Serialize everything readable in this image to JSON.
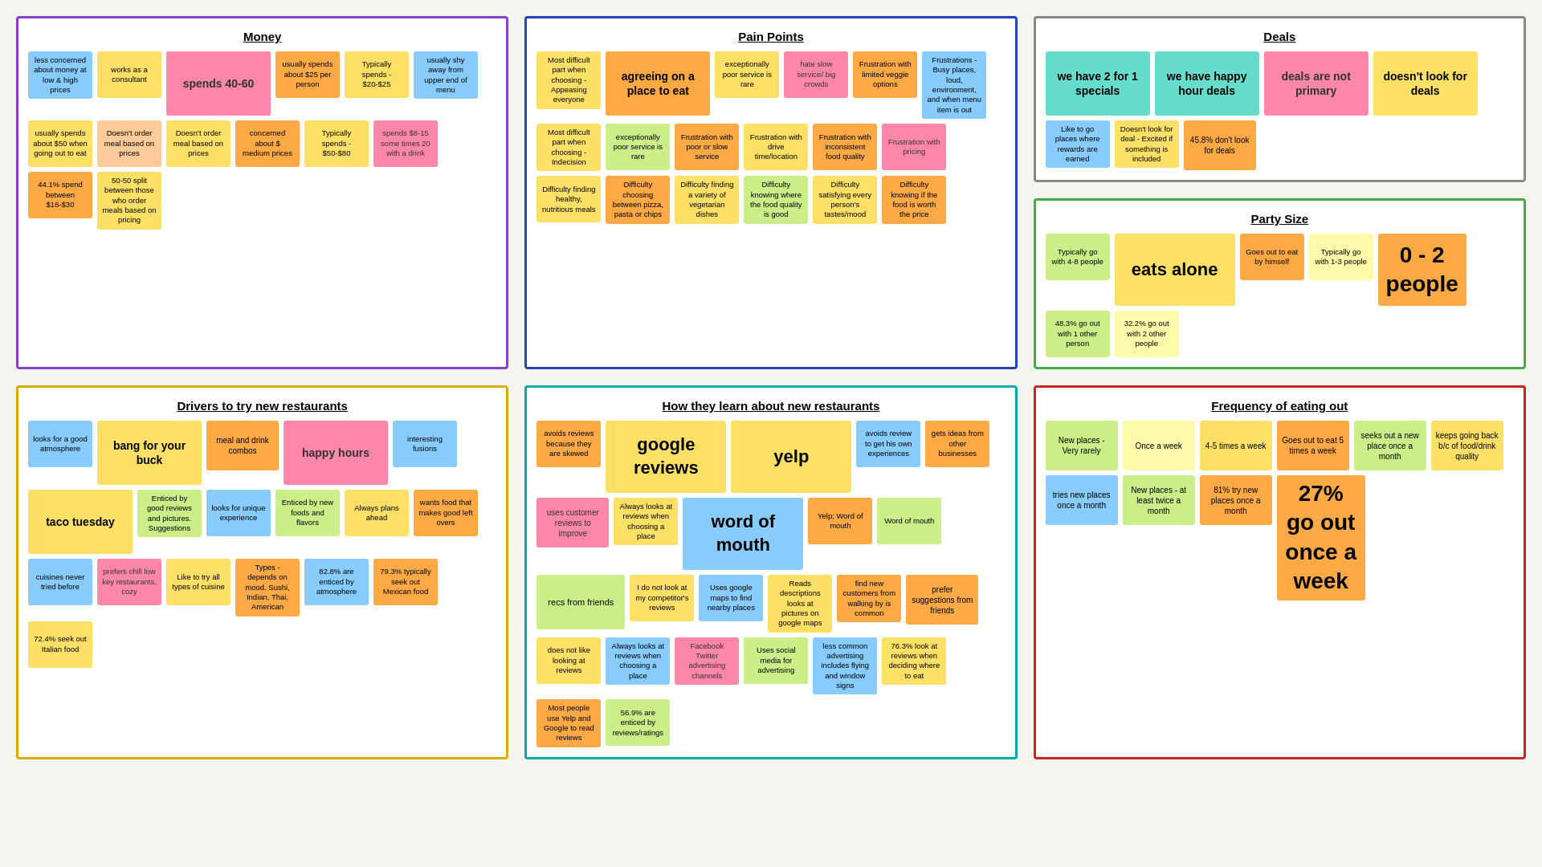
{
  "sections": {
    "money": {
      "title": "Money",
      "border": "purple",
      "stickies": [
        {
          "text": "less concerned about money at low & high prices",
          "color": "s-lblue",
          "size": "sz-sm"
        },
        {
          "text": "works as a consultant",
          "color": "s-yellow",
          "size": "sz-sm"
        },
        {
          "text": "spends 40-60",
          "color": "s-pink",
          "size": "sz-xl"
        },
        {
          "text": "usually spends about $25 per person",
          "color": "s-orange",
          "size": "sz-sm"
        },
        {
          "text": "Typically spends - $20-$25",
          "color": "s-yellow",
          "size": "sz-sm"
        },
        {
          "text": "usually shy away from upper end of menu",
          "color": "s-lblue",
          "size": "sz-sm"
        },
        {
          "text": "usually spends about $50 when going out to eat",
          "color": "s-yellow",
          "size": "sz-sm"
        },
        {
          "text": "Doesn't order meal based on prices",
          "color": "s-peach",
          "size": "sz-sm"
        },
        {
          "text": "Doesn't order meal based on prices",
          "color": "s-yellow",
          "size": "sz-sm"
        },
        {
          "text": "concerned about $ medium prices",
          "color": "s-orange",
          "size": "sz-sm"
        },
        {
          "text": "Typically spends - $50-$80",
          "color": "s-yellow",
          "size": "sz-sm"
        },
        {
          "text": "spends $8-15 some times 20 with a drink",
          "color": "s-pink",
          "size": "sz-sm"
        },
        {
          "text": "44.1% spend between $16-$30",
          "color": "s-orange",
          "size": "sz-sm"
        },
        {
          "text": "50-50 split between those who order meals based on pricing",
          "color": "s-yellow",
          "size": "sz-sm"
        }
      ]
    },
    "painpoints": {
      "title": "Pain Points",
      "border": "blue",
      "stickies": [
        {
          "text": "Most difficult part when choosing - Appeasing everyone",
          "color": "s-yellow",
          "size": "sz-sm"
        },
        {
          "text": "agreeing on a place to eat",
          "color": "s-orange",
          "size": "sz-xl"
        },
        {
          "text": "exceptionally poor service is rare",
          "color": "s-yellow",
          "size": "sz-sm"
        },
        {
          "text": "hate slow service/ big crowds",
          "color": "s-pink",
          "size": "sz-sm"
        },
        {
          "text": "Frustration with limited veggie options",
          "color": "s-orange",
          "size": "sz-sm"
        },
        {
          "text": "Frustrations - Busy places, loud, environment, and when menu item is out",
          "color": "s-lblue",
          "size": "sz-sm"
        },
        {
          "text": "Most difficult part when choosing - Indecision",
          "color": "s-yellow",
          "size": "sz-sm"
        },
        {
          "text": "exceptionally poor service is rare",
          "color": "s-lgreen",
          "size": "sz-sm"
        },
        {
          "text": "Frustration with poor or slow service",
          "color": "s-orange",
          "size": "sz-sm"
        },
        {
          "text": "Frustration with drive time/location",
          "color": "s-yellow",
          "size": "sz-sm"
        },
        {
          "text": "Frustration with inconsistent food quality",
          "color": "s-orange",
          "size": "sz-sm"
        },
        {
          "text": "Frustration with pricing",
          "color": "s-pink",
          "size": "sz-sm"
        },
        {
          "text": "Difficulty finding healthy, nutritious meals",
          "color": "s-yellow",
          "size": "sz-sm"
        },
        {
          "text": "Difficulty choosing between pizza, pasta or chips",
          "color": "s-orange",
          "size": "sz-sm"
        },
        {
          "text": "Difficulty finding a variety of vegetarian dishes",
          "color": "s-yellow",
          "size": "sz-sm"
        },
        {
          "text": "Difficulty knowing where the food quality is good",
          "color": "s-lgreen",
          "size": "sz-sm"
        },
        {
          "text": "Difficulty satisfying every person's tastes/mood",
          "color": "s-yellow",
          "size": "sz-sm"
        },
        {
          "text": "Difficulty knowing if the food is worth the price",
          "color": "s-orange",
          "size": "sz-sm"
        }
      ]
    },
    "deals": {
      "title": "Deals",
      "border": "gray",
      "stickies": [
        {
          "text": "we have 2 for 1 specials",
          "color": "s-teal",
          "size": "sz-xl"
        },
        {
          "text": "we have happy hour deals",
          "color": "s-teal",
          "size": "sz-xl"
        },
        {
          "text": "deals are not primary",
          "color": "s-pink",
          "size": "sz-xl"
        },
        {
          "text": "doesn't look for deals",
          "color": "s-yellow",
          "size": "sz-xl"
        },
        {
          "text": "Like to go places where rewards are earned",
          "color": "s-lblue",
          "size": "sz-sm"
        },
        {
          "text": "Doesn't look for deal - Excited if something is included",
          "color": "s-yellow",
          "size": "sz-sm"
        },
        {
          "text": "45.8% don't look for deals",
          "color": "s-orange",
          "size": "sz-md"
        }
      ]
    },
    "partysize": {
      "title": "Party Size",
      "border": "green",
      "stickies": [
        {
          "text": "Typically go with 4-8 people",
          "color": "s-lgreen",
          "size": "sz-sm"
        },
        {
          "text": "eats alone",
          "color": "s-yellow",
          "size": "sz-xxl"
        },
        {
          "text": "Goes out to eat by himself",
          "color": "s-orange",
          "size": "sz-sm"
        },
        {
          "text": "Typically go with 1-3 people",
          "color": "s-lyellow",
          "size": "sz-sm"
        },
        {
          "text": "0 - 2 people",
          "color": "s-orange",
          "size": "sz-huge"
        },
        {
          "text": "48.3% go out with 1 other person",
          "color": "s-lgreen",
          "size": "sz-sm"
        },
        {
          "text": "32.2% go out with 2 other people",
          "color": "s-lyellow",
          "size": "sz-sm"
        }
      ]
    },
    "drivers": {
      "title": "Drivers to try new restaurants",
      "border": "yellow",
      "stickies": [
        {
          "text": "looks for a good atmosphere",
          "color": "s-lblue",
          "size": "sz-sm"
        },
        {
          "text": "bang for your buck",
          "color": "s-yellow",
          "size": "sz-xl"
        },
        {
          "text": "meal and drink combos",
          "color": "s-orange",
          "size": "sz-md"
        },
        {
          "text": "happy hours",
          "color": "s-pink",
          "size": "sz-xl"
        },
        {
          "text": "interesting fusions",
          "color": "s-lblue",
          "size": "sz-sm"
        },
        {
          "text": "taco tuesday",
          "color": "s-yellow",
          "size": "sz-xl"
        },
        {
          "text": "Enticed by good reviews and pictures. Suggestions",
          "color": "s-lgreen",
          "size": "sz-sm"
        },
        {
          "text": "looks for unique experience",
          "color": "s-lblue",
          "size": "sz-sm"
        },
        {
          "text": "Enticed by new foods and flavors",
          "color": "s-lgreen",
          "size": "sz-sm"
        },
        {
          "text": "Always plans ahead",
          "color": "s-yellow",
          "size": "sz-sm"
        },
        {
          "text": "wants food that makes good left overs",
          "color": "s-orange",
          "size": "sz-sm"
        },
        {
          "text": "cuisines never tried before",
          "color": "s-lblue",
          "size": "sz-sm"
        },
        {
          "text": "prefers chill low key restaurants, cozy",
          "color": "s-pink",
          "size": "sz-sm"
        },
        {
          "text": "Like to try all types of cuisine",
          "color": "s-yellow",
          "size": "sz-sm"
        },
        {
          "text": "Types - depends on mood. Sushi, Indian, Thai, American",
          "color": "s-orange",
          "size": "sz-sm"
        },
        {
          "text": "82.8% are enticed by atmosphere",
          "color": "s-lblue",
          "size": "sz-sm"
        },
        {
          "text": "79.3% typically seek out Mexican food",
          "color": "s-orange",
          "size": "sz-sm"
        },
        {
          "text": "72.4% seek out Italian food",
          "color": "s-yellow",
          "size": "sz-sm"
        }
      ]
    },
    "learn": {
      "title": "How they learn about new restaurants",
      "border": "teal",
      "stickies": [
        {
          "text": "avoids reviews because they are skewed",
          "color": "s-orange",
          "size": "sz-sm"
        },
        {
          "text": "google reviews",
          "color": "s-yellow",
          "size": "sz-xxl"
        },
        {
          "text": "yelp",
          "color": "s-yellow",
          "size": "sz-xxl"
        },
        {
          "text": "avoids review to get his own experiences",
          "color": "s-lblue",
          "size": "sz-sm"
        },
        {
          "text": "gets ideas from other businesses",
          "color": "s-orange",
          "size": "sz-sm"
        },
        {
          "text": "uses customer reviews to improve",
          "color": "s-pink",
          "size": "sz-md"
        },
        {
          "text": "Always looks at reviews when choosing a place",
          "color": "s-yellow",
          "size": "sz-sm"
        },
        {
          "text": "word of mouth",
          "color": "s-lblue",
          "size": "sz-xxl"
        },
        {
          "text": "Yelp; Word of mouth",
          "color": "s-orange",
          "size": "sz-sm"
        },
        {
          "text": "Word of mouth",
          "color": "s-lgreen",
          "size": "sz-sm"
        },
        {
          "text": "recs from friends",
          "color": "s-lgreen",
          "size": "sz-lg"
        },
        {
          "text": "I do not look at my competitor's reviews",
          "color": "s-yellow",
          "size": "sz-sm"
        },
        {
          "text": "Uses google maps to find nearby places",
          "color": "s-lblue",
          "size": "sz-sm"
        },
        {
          "text": "Reads descriptions looks at pictures on google maps",
          "color": "s-yellow",
          "size": "sz-sm"
        },
        {
          "text": "find new customers from walking by is common",
          "color": "s-orange",
          "size": "sz-sm"
        },
        {
          "text": "prefer suggestions from friends",
          "color": "s-orange",
          "size": "sz-md"
        },
        {
          "text": "does not like looking at reviews",
          "color": "s-yellow",
          "size": "sz-sm"
        },
        {
          "text": "Always looks at reviews when choosing a place",
          "color": "s-lblue",
          "size": "sz-sm"
        },
        {
          "text": "Facebook Twitter advertising channels",
          "color": "s-pink",
          "size": "sz-sm"
        },
        {
          "text": "Uses social media for advertising",
          "color": "s-lgreen",
          "size": "sz-sm"
        },
        {
          "text": "less common advertising includes flying and window signs",
          "color": "s-lblue",
          "size": "sz-sm"
        },
        {
          "text": "76.3% look at reviews when deciding where to eat",
          "color": "s-yellow",
          "size": "sz-sm"
        },
        {
          "text": "Most people use Yelp and Google to read reviews",
          "color": "s-orange",
          "size": "sz-sm"
        },
        {
          "text": "56.9% are enticed by reviews/ratings",
          "color": "s-lgreen",
          "size": "sz-sm"
        }
      ]
    },
    "frequency": {
      "title": "Frequency of eating out",
      "border": "red",
      "stickies": [
        {
          "text": "New places - Very rarely",
          "color": "s-lgreen",
          "size": "sz-md"
        },
        {
          "text": "Once a week",
          "color": "s-lyellow",
          "size": "sz-md"
        },
        {
          "text": "4-5 times a week",
          "color": "s-yellow",
          "size": "sz-md"
        },
        {
          "text": "Goes out to eat 5 times a week",
          "color": "s-orange",
          "size": "sz-md"
        },
        {
          "text": "seeks out a new place once a month",
          "color": "s-lgreen",
          "size": "sz-md"
        },
        {
          "text": "keeps going back b/c of food/drink quality",
          "color": "s-yellow",
          "size": "sz-md"
        },
        {
          "text": "tries new places once a month",
          "color": "s-lblue",
          "size": "sz-md"
        },
        {
          "text": "New places - at least twice a month",
          "color": "s-lgreen",
          "size": "sz-md"
        },
        {
          "text": "81% try new places once a month",
          "color": "s-orange",
          "size": "sz-md"
        },
        {
          "text": "27% go out once a week",
          "color": "s-orange",
          "size": "sz-huge"
        }
      ]
    }
  }
}
